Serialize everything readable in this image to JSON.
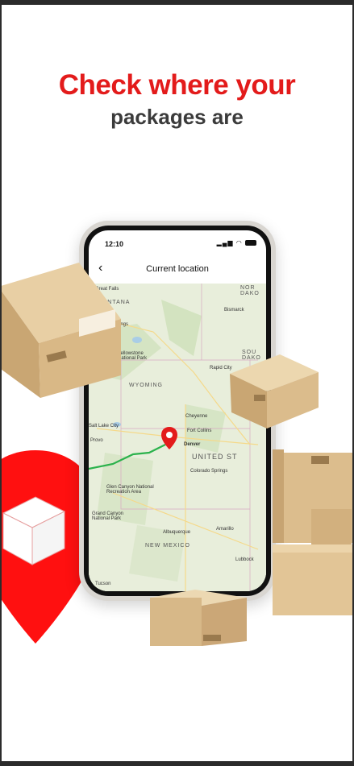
{
  "headline": {
    "line1": "Check where your",
    "line2": "packages are"
  },
  "phone": {
    "status_time": "12:10",
    "nav_title": "Current location",
    "map": {
      "regions": [
        "MONTANA",
        "WYOMING",
        "NEW MEXICO",
        "UNITED ST",
        "NOR DAKO",
        "SOU DAKO"
      ],
      "cities": [
        "Great Falls",
        "Bismarck",
        "Billings",
        "Yellowstone National Park",
        "Rapid City",
        "Cheyenne",
        "Salt Lake City",
        "Fort Collins",
        "Denver",
        "Provo",
        "Colorado Springs",
        "Glen Canyon National Recreation Area",
        "Grand Canyon National Park",
        "Albuquerque",
        "Amarillo",
        "Lubbock",
        "Tucson"
      ]
    }
  },
  "colors": {
    "brand_red": "#e31b1b",
    "route_green": "#2bb24c"
  }
}
